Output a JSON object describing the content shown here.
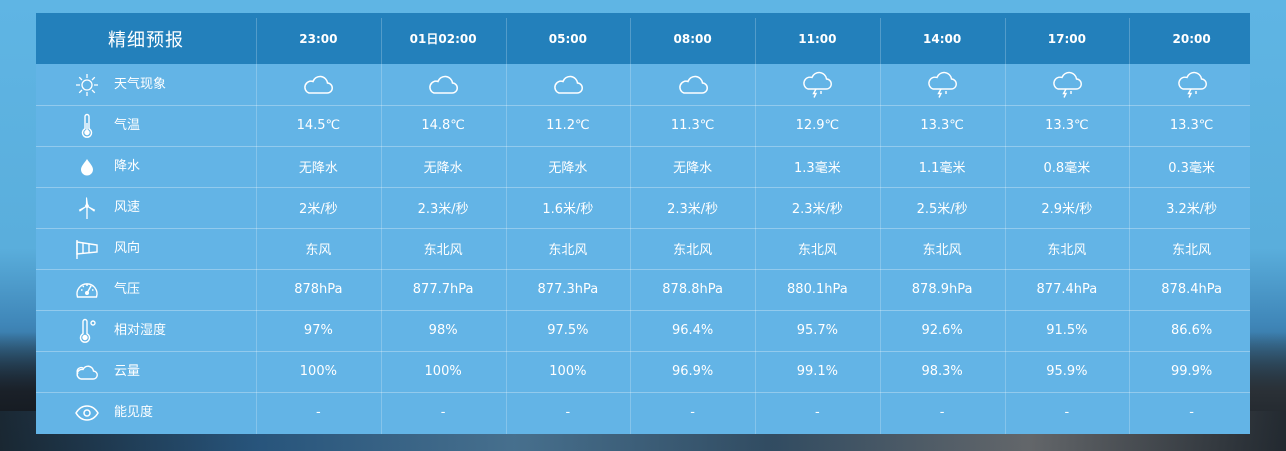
{
  "title": "精细预报",
  "times": [
    "23:00",
    "01日02:00",
    "05:00",
    "08:00",
    "11:00",
    "14:00",
    "17:00",
    "20:00"
  ],
  "rows": [
    {
      "label": "天气现象",
      "icon": "sun-icon",
      "values": [
        "cloudy",
        "cloudy",
        "cloudy",
        "cloudy",
        "thunder-shower",
        "thunder-shower",
        "thunder-shower",
        "thunder-shower"
      ]
    },
    {
      "label": "气温",
      "icon": "thermometer-icon",
      "values": [
        "14.5℃",
        "14.8℃",
        "11.2℃",
        "11.3℃",
        "12.9℃",
        "13.3℃",
        "13.3℃",
        "13.3℃"
      ]
    },
    {
      "label": "降水",
      "icon": "raindrop-icon",
      "values": [
        "无降水",
        "无降水",
        "无降水",
        "无降水",
        "1.3毫米",
        "1.1毫米",
        "0.8毫米",
        "0.3毫米"
      ]
    },
    {
      "label": "风速",
      "icon": "wind-turbine-icon",
      "values": [
        "2米/秒",
        "2.3米/秒",
        "1.6米/秒",
        "2.3米/秒",
        "2.3米/秒",
        "2.5米/秒",
        "2.9米/秒",
        "3.2米/秒"
      ]
    },
    {
      "label": "风向",
      "icon": "windsock-icon",
      "values": [
        "东风",
        "东北风",
        "东北风",
        "东北风",
        "东北风",
        "东北风",
        "东北风",
        "东北风"
      ]
    },
    {
      "label": "气压",
      "icon": "gauge-icon",
      "values": [
        "878hPa",
        "877.7hPa",
        "877.3hPa",
        "878.8hPa",
        "880.1hPa",
        "878.9hPa",
        "877.4hPa",
        "878.4hPa"
      ]
    },
    {
      "label": "相对湿度",
      "icon": "hygrometer-icon",
      "values": [
        "97%",
        "98%",
        "97.5%",
        "96.4%",
        "95.7%",
        "92.6%",
        "91.5%",
        "86.6%"
      ]
    },
    {
      "label": "云量",
      "icon": "cloud-icon",
      "values": [
        "100%",
        "100%",
        "100%",
        "96.9%",
        "99.1%",
        "98.3%",
        "95.9%",
        "99.9%"
      ]
    },
    {
      "label": "能见度",
      "icon": "eye-icon",
      "values": [
        "-",
        "-",
        "-",
        "-",
        "-",
        "-",
        "-",
        "-"
      ]
    }
  ]
}
